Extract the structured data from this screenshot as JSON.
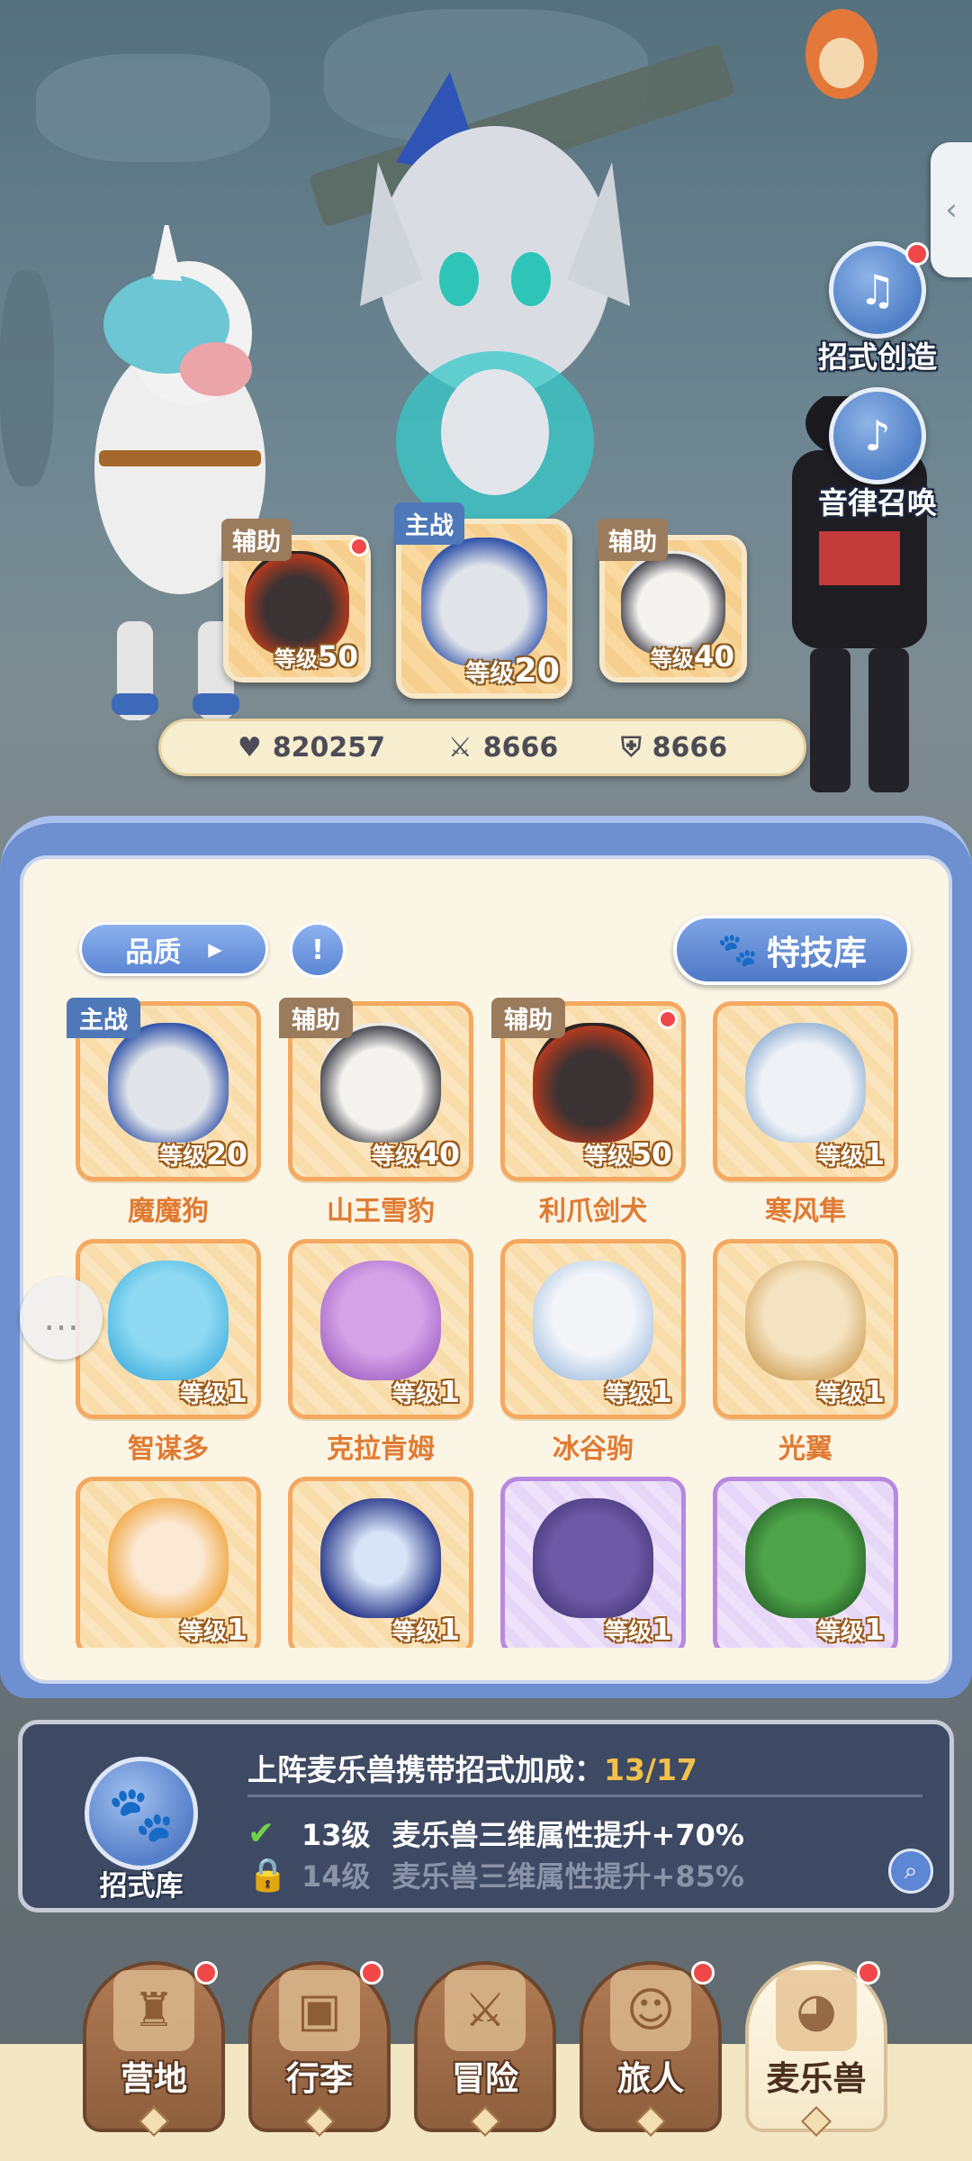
{
  "side": {
    "create_label": "招式创造",
    "summon_label": "音律召唤"
  },
  "team": {
    "slots": [
      {
        "tag": "辅助",
        "level_label": "等级",
        "level": "50"
      },
      {
        "tag": "主战",
        "level_label": "等级",
        "level": "20"
      },
      {
        "tag": "辅助",
        "level_label": "等级",
        "level": "40"
      }
    ],
    "stats": {
      "hp": "820257",
      "attack": "8666",
      "defense": "8666"
    }
  },
  "toolbar": {
    "quality_label": "品质",
    "skill_library_label": "特技库"
  },
  "monsters": [
    {
      "name": "魔魔狗",
      "tag": "主战",
      "level_label": "等级",
      "level": "20"
    },
    {
      "name": "山王雪豹",
      "tag": "辅助",
      "level_label": "等级",
      "level": "40"
    },
    {
      "name": "利爪剑犬",
      "tag": "辅助",
      "level_label": "等级",
      "level": "50"
    },
    {
      "name": "寒风隼",
      "tag": "",
      "level_label": "等级",
      "level": "1"
    },
    {
      "name": "智谋多",
      "tag": "",
      "level_label": "等级",
      "level": "1"
    },
    {
      "name": "克拉肯姆",
      "tag": "",
      "level_label": "等级",
      "level": "1"
    },
    {
      "name": "冰谷驹",
      "tag": "",
      "level_label": "等级",
      "level": "1"
    },
    {
      "name": "光翼",
      "tag": "",
      "level_label": "等级",
      "level": "1"
    },
    {
      "name": "",
      "tag": "",
      "level_label": "等级",
      "level": "1"
    },
    {
      "name": "",
      "tag": "",
      "level_label": "等级",
      "level": "1"
    },
    {
      "name": "",
      "tag": "",
      "level_label": "等级",
      "level": "1"
    },
    {
      "name": "",
      "tag": "",
      "level_label": "等级",
      "level": "1"
    }
  ],
  "bonus": {
    "library_label": "招式库",
    "title": "上阵麦乐兽携带招式加成：",
    "progress": "13/17",
    "rows": [
      {
        "level": "13级",
        "text": "麦乐兽三维属性提升+70%"
      },
      {
        "level": "14级",
        "text": "麦乐兽三维属性提升+85%"
      }
    ]
  },
  "nav": {
    "items": [
      {
        "label": "营地"
      },
      {
        "label": "行李"
      },
      {
        "label": "冒险"
      },
      {
        "label": "旅人"
      },
      {
        "label": "麦乐兽"
      }
    ]
  },
  "colors": {
    "accent_blue": "#5c86d4",
    "name_orange": "#e07b32",
    "progress_gold": "#f3c14b",
    "check_green": "#6fd14b",
    "notify_red": "#f04848"
  }
}
